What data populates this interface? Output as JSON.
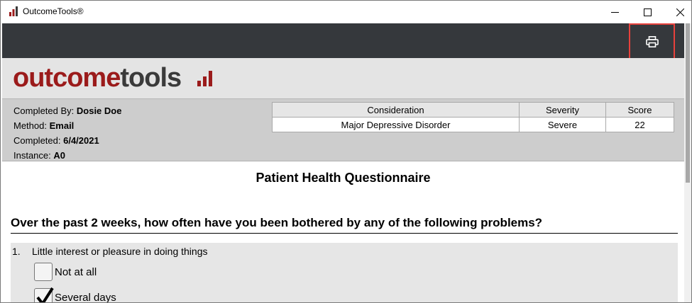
{
  "window": {
    "title": "OutcomeTools®"
  },
  "toolbar": {
    "print_icon": "printer-icon"
  },
  "logo": {
    "part1": "outcome",
    "part2": "tools"
  },
  "meta": {
    "completed_by_label": "Completed By:",
    "completed_by": "Dosie Doe",
    "method_label": "Method:",
    "method": "Email",
    "completed_label": "Completed:",
    "completed": "6/4/2021",
    "instance_label": "Instance:",
    "instance": "A0"
  },
  "results": {
    "headers": [
      "Consideration",
      "Severity",
      "Score"
    ],
    "rows": [
      [
        "Major Depressive Disorder",
        "Severe",
        "22"
      ]
    ]
  },
  "questionnaire": {
    "title": "Patient Health Questionnaire",
    "instruction": "Over the past 2 weeks, how often have you been bothered by any of the following problems?",
    "items": [
      {
        "number": "1.",
        "text": "Little interest or pleasure in doing things",
        "options": [
          {
            "label": "Not at all",
            "checked": false
          },
          {
            "label": "Several days",
            "checked": true
          }
        ]
      }
    ]
  },
  "colors": {
    "brand_red": "#9b1b1b",
    "toolbar": "#35383c",
    "highlight": "#e8413c"
  }
}
